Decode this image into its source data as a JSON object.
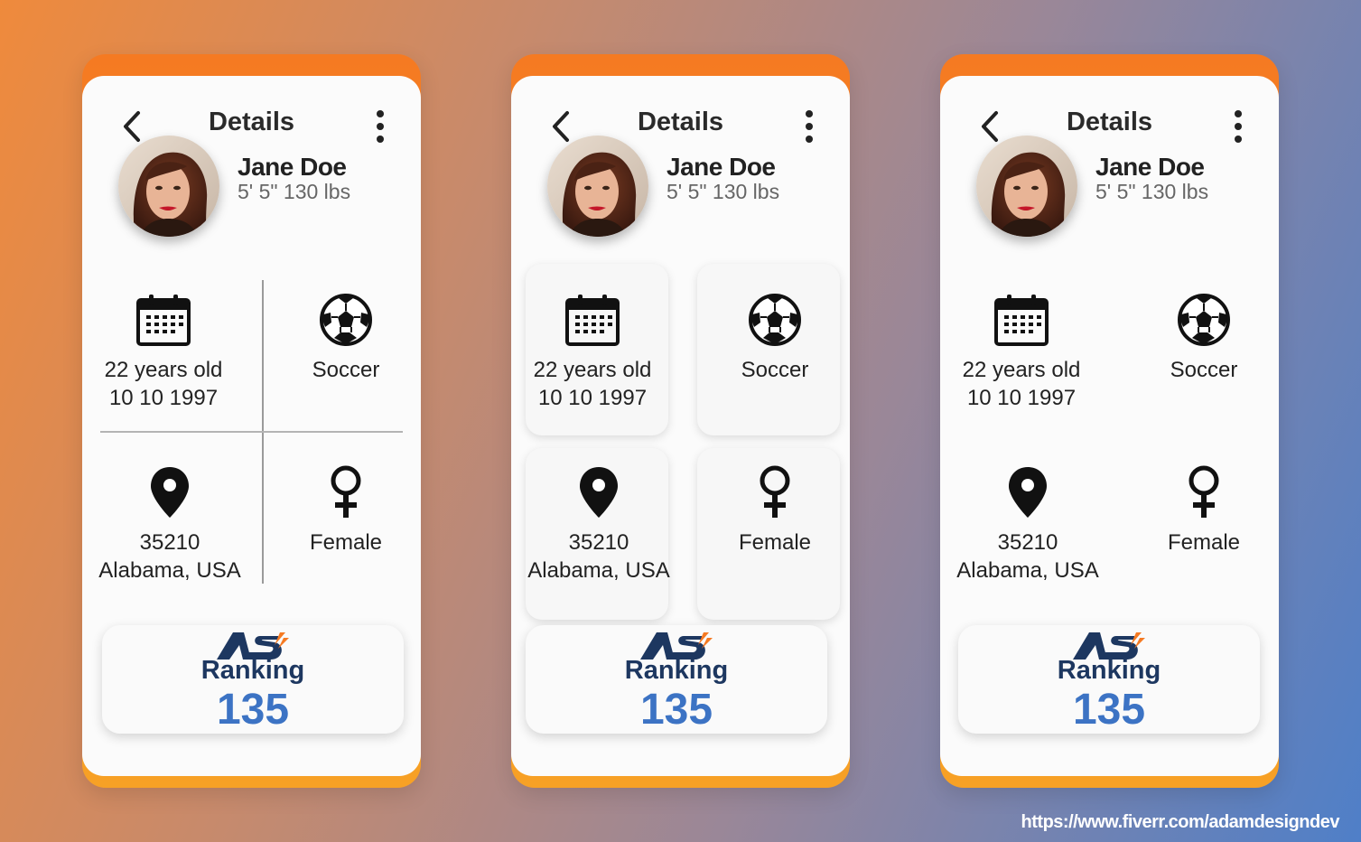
{
  "header": {
    "title": "Details",
    "back_icon": "chevron-left-icon",
    "menu_icon": "more-vertical-icon"
  },
  "profile": {
    "name": "Jane Doe",
    "stats": "5' 5\" 130 lbs"
  },
  "info": {
    "age_line1": "22 years old",
    "age_line2": "10 10 1997",
    "sport": "Soccer",
    "zip": "35210",
    "location": "Alabama, USA",
    "gender": "Female"
  },
  "ranking": {
    "logo_text": "AS",
    "label": "Ranking",
    "value": "135"
  },
  "footer": {
    "url": "https://www.fiverr.com/adamdesigndev"
  },
  "colors": {
    "accent_orange": "#f57a22",
    "accent_yellow": "#f7a125",
    "rank_value_blue": "#3c73c4",
    "rank_label_navy": "#1d3760",
    "background_start": "#ef8a3c",
    "background_end": "#4f7fc8"
  }
}
